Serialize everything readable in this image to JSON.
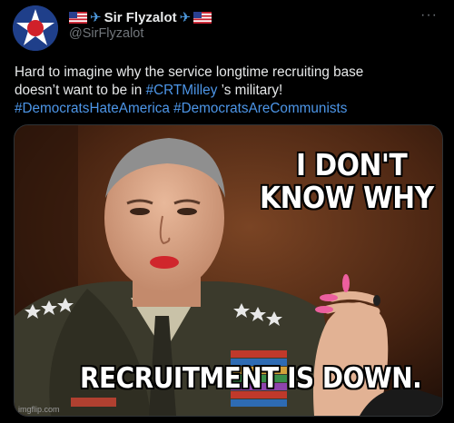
{
  "author": {
    "display_name": "Sir Flyzalot",
    "handle": "@SirFlyzalot",
    "avatar_icon": "roundel-star-icon",
    "badges": [
      "us-flag-icon",
      "airplane-icon",
      "airplane-icon",
      "us-flag-icon"
    ]
  },
  "menu": {
    "more_label": "···"
  },
  "tweet": {
    "text_line1": "Hard to imagine why the service longtime recruiting base",
    "text_line2_prefix": "doesn’t want to be in ",
    "hashtag_1": "#CRTMilley",
    "text_line2_suffix": " ’s military!",
    "hashtag_2": "#DemocratsHateAmerica",
    "hashtag_3": "#DemocratsAreCommunists"
  },
  "media": {
    "caption_top_line1": "I DON'T",
    "caption_top_line2": "KNOW WHY",
    "caption_bottom": "RECRUITMENT IS DOWN.",
    "watermark": "imgflip.com"
  },
  "colors": {
    "background": "#000000",
    "text": "#e7e9ea",
    "secondary_text": "#71767b",
    "hashtag": "#4d96e8"
  }
}
